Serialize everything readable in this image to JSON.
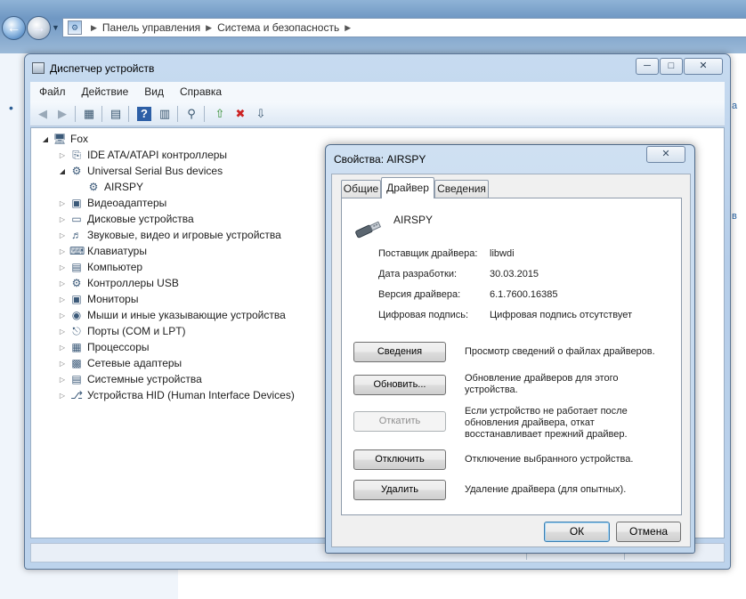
{
  "explorer": {
    "breadcrumbs": [
      "Панель управления",
      "Система и безопасность"
    ],
    "back_icon": "back-arrow-icon",
    "forward_icon": "forward-arrow-icon"
  },
  "device_manager": {
    "title": "Диспетчер устройств",
    "menu": [
      "Файл",
      "Действие",
      "Вид",
      "Справка"
    ],
    "toolbar_icons": [
      "back-icon",
      "forward-icon",
      "show-hide-tree-icon",
      "properties-icon",
      "help-icon",
      "view-icon",
      "scan-hardware-icon",
      "update-driver-icon",
      "disable-device-icon",
      "uninstall-device-icon"
    ],
    "tree": {
      "root": "Fox",
      "items": [
        {
          "label": "IDE ATA/ATAPI контроллеры",
          "icon": "ide-controller-icon",
          "expanded": false
        },
        {
          "label": "Universal Serial Bus devices",
          "icon": "usb-icon",
          "expanded": true,
          "children": [
            "AIRSPY"
          ]
        },
        {
          "label": "Видеоадаптеры",
          "icon": "display-adapter-icon",
          "expanded": false
        },
        {
          "label": "Дисковые устройства",
          "icon": "disk-drive-icon",
          "expanded": false
        },
        {
          "label": "Звуковые, видео и игровые устройства",
          "icon": "sound-icon",
          "expanded": false
        },
        {
          "label": "Клавиатуры",
          "icon": "keyboard-icon",
          "expanded": false
        },
        {
          "label": "Компьютер",
          "icon": "computer-icon",
          "expanded": false
        },
        {
          "label": "Контроллеры USB",
          "icon": "usb-controller-icon",
          "expanded": false
        },
        {
          "label": "Мониторы",
          "icon": "monitor-icon",
          "expanded": false
        },
        {
          "label": "Мыши и иные указывающие устройства",
          "icon": "mouse-icon",
          "expanded": false
        },
        {
          "label": "Порты (COM и LPT)",
          "icon": "port-icon",
          "expanded": false
        },
        {
          "label": "Процессоры",
          "icon": "processor-icon",
          "expanded": false
        },
        {
          "label": "Сетевые адаптеры",
          "icon": "network-adapter-icon",
          "expanded": false
        },
        {
          "label": "Системные устройства",
          "icon": "system-device-icon",
          "expanded": false
        },
        {
          "label": "Устройства HID (Human Interface Devices)",
          "icon": "hid-icon",
          "expanded": false
        }
      ]
    }
  },
  "properties": {
    "title": "Свойства: AIRSPY",
    "tabs": [
      "Общие",
      "Драйвер",
      "Сведения"
    ],
    "active_tab": "Драйвер",
    "device_name": "AIRSPY",
    "info": [
      {
        "label": "Поставщик драйвера:",
        "value": "libwdi"
      },
      {
        "label": "Дата разработки:",
        "value": "30.03.2015"
      },
      {
        "label": "Версия драйвера:",
        "value": "6.1.7600.16385"
      },
      {
        "label": "Цифровая подпись:",
        "value": "Цифровая подпись отсутствует"
      }
    ],
    "actions": [
      {
        "label": "Сведения",
        "desc": "Просмотр сведений о файлах драйверов.",
        "enabled": true
      },
      {
        "label": "Обновить...",
        "desc": "Обновление драйверов для этого устройства.",
        "enabled": true
      },
      {
        "label": "Откатить",
        "desc": "Если устройство не работает после обновления драйвера, откат восстанавливает прежний драйвер.",
        "enabled": false
      },
      {
        "label": "Отключить",
        "desc": "Отключение выбранного устройства.",
        "enabled": true
      },
      {
        "label": "Удалить",
        "desc": "Удаление драйвера (для опытных).",
        "enabled": true
      }
    ],
    "ok_label": "ОК",
    "cancel_label": "Отмена"
  }
}
